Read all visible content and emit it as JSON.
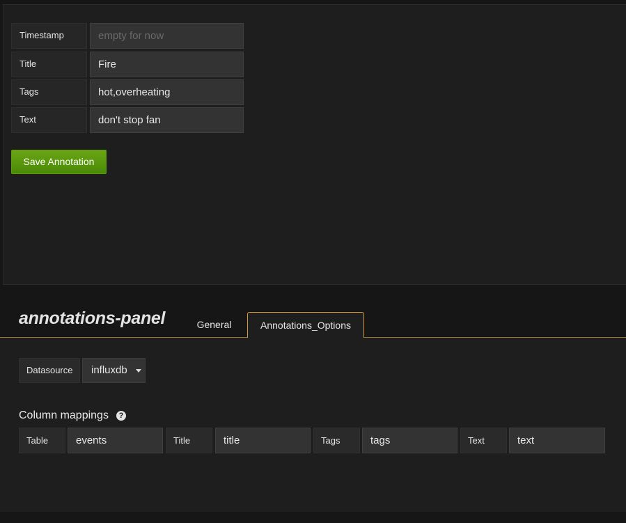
{
  "annotation_form": {
    "rows": [
      {
        "label": "Timestamp",
        "value": "",
        "placeholder": "empty for now"
      },
      {
        "label": "Title",
        "value": "Fire",
        "placeholder": ""
      },
      {
        "label": "Tags",
        "value": "hot,overheating",
        "placeholder": ""
      },
      {
        "label": "Text",
        "value": "don't stop fan",
        "placeholder": ""
      }
    ],
    "save_label": "Save Annotation"
  },
  "editor": {
    "title": "annotations-panel",
    "tabs": [
      {
        "label": "General",
        "active": false
      },
      {
        "label": "Annotations_Options",
        "active": true
      }
    ],
    "datasource": {
      "label": "Datasource",
      "selected": "influxdb"
    },
    "column_mappings": {
      "title": "Column mappings",
      "help_icon": "question-circle-icon",
      "fields": [
        {
          "label": "Table",
          "value": "events"
        },
        {
          "label": "Title",
          "value": "title"
        },
        {
          "label": "Tags",
          "value": "tags"
        },
        {
          "label": "Text",
          "value": "text"
        }
      ]
    }
  },
  "colors": {
    "accent_tab_border": "#d69a2f",
    "save_button": "#5f9a11",
    "panel_bg": "#1f1e1f"
  }
}
